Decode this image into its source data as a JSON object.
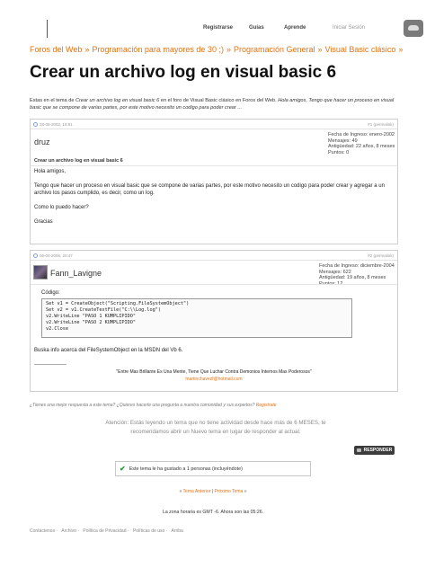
{
  "topnav": {
    "register": "Registrarse",
    "guides": "Guías",
    "learn": "Aprende",
    "login": "Iniciar Sesión"
  },
  "breadcrumb": {
    "items": [
      "Foros del Web",
      "Programación para mayores de 30 ;)",
      "Programación General",
      "Visual Basic clásico"
    ],
    "separator": "»"
  },
  "page": {
    "title": "Crear un archivo log en visual basic 6"
  },
  "intro": {
    "prefix": "Estas en el tema de",
    "topic": "Crear un archivo log en visual basic 6",
    "middle": "en el foro de Visual Basic clásico en Foros del Web.",
    "excerpt": "Hola amigos, Tengo que hacer un proceso en visual basic que se compone de varias partes, por este motivo necesito un codigo para poder crear ..."
  },
  "posts": [
    {
      "date": "28-08-2002, 18:51",
      "permalink": "#1 (permalink)",
      "username": "druz",
      "info": [
        "Fecha de Ingreso: enero-2002",
        "Mensajes: 49",
        "Antigüedad: 22 años, 8 meses",
        "Puntos: 0"
      ],
      "subject": "Crear un archivo log en visual basic 6",
      "body": [
        "Hola amigos,",
        "Tengo que hacer un proceso en visual basic que se compone de varias partes, por este motivo necesito un codigo para poder crear y agregar a un archivo los pasos cumplido, es decir, como un log.",
        "Como lo puedo hacer?",
        "Gracias"
      ]
    },
    {
      "date": "06-04-2006, 20:47",
      "permalink": "#2 (permalink)",
      "username": "Fann_Lavigne",
      "info": [
        "Fecha de Ingreso: diciembre-2004",
        "Mensajes: 622",
        "Antigüedad: 19 años, 8 meses",
        "Puntos: 12"
      ],
      "code_label": "Código:",
      "code": "Set v1 = CreateObject(\"Scripting.FileSystemObject\")\nSet v2 = v1.CreateTextFile(\"C:\\\\Log.log\")\nv2.WriteLine \"PASO 1 KUMPLIPIDO\"\nv2.WriteLine \"PASO 2 KUMPLIPIDO\"\nv2.Close",
      "body_after": "Buska info acerca del FileSystemObject en la MSDN del Vb 6.",
      "divider": "------------------",
      "signature_quote": "\"Entre Mas Brillante Es Una Mente, Tiene Que Luchar Contra Demonios Internos Mas Poderosos\"",
      "signature_email": "martinchavezf@hotmail.com"
    }
  ],
  "better_answer": {
    "text": "¿Tienes una mejor respuesta a este tema? ¿Quieres hacerle una pregunta a nuestra comunidad y sus expertos?",
    "link": "Registrate"
  },
  "warning": "Atención: Estás leyendo un tema que no tiene actividad desde hace más de 6 MESES, te recomendamos abrir un Nuevo tema en lugar de responder al actual.",
  "reply_button": "RESPONDER",
  "likes": "Este tema le ha gustado a 1 personas (incluyéndote)",
  "pager": {
    "prev": "Tema Anterior",
    "sep": "|",
    "next": "Próximo Tema"
  },
  "timezone": "La zona horaria es GMT -6. Ahora son las 05:26.",
  "footer": [
    "Contáctenos",
    "Archivo",
    "Política de Privacidad",
    "Políticas de uso",
    "Arriba"
  ],
  "colors": {
    "accent": "#e67312",
    "border": "#cfcfcf"
  }
}
